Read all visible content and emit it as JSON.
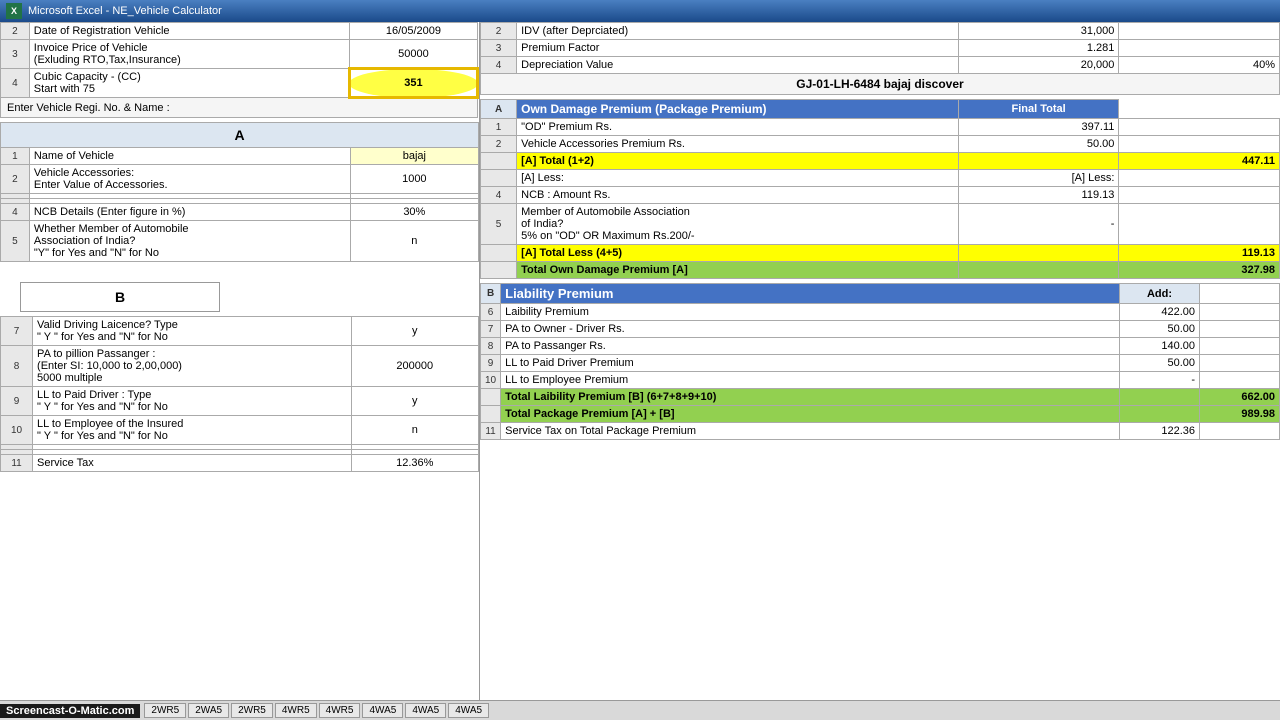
{
  "titleBar": {
    "label": "Microsoft Excel - NE_Vehicle Calculator"
  },
  "topSection": {
    "rows": [
      {
        "num": "2",
        "label": "Date of Registration Vehicle",
        "value": "16/05/2009"
      },
      {
        "num": "3",
        "label1": "Invoice Price of Vehicle",
        "label2": "(Exluding RTO,Tax,Insurance)",
        "value": "50000"
      },
      {
        "num": "4",
        "label1": "Cubic Capacity - (CC)",
        "label2": "Start with 75",
        "value": "351"
      }
    ],
    "regiLabel": "Enter Vehicle Regi. No. & Name :",
    "regiValue": "GJ-01-LH-6484  bajaj discover"
  },
  "rightTopRows": [
    {
      "num": "2",
      "label": "IDV (after Deprciated)",
      "value": "31,000"
    },
    {
      "num": "3",
      "label": "Premium Factor",
      "value": "1.281"
    },
    {
      "num": "4",
      "label": "Depreciation Value",
      "value": "20,000",
      "pct": "40%"
    }
  ],
  "sectionA": {
    "header": "A",
    "tableAHeader": "Own Damage Premium (Package Premium)",
    "finalTotalHeader": "Final Total",
    "rows": [
      {
        "num": "1",
        "label": "Name of Vehicle",
        "value": "bajaj"
      },
      {
        "num": "2",
        "label1": "Vehicle Accessories:",
        "label2": "Enter Value of Accessories.",
        "value": "1000"
      }
    ]
  },
  "rightSectionA": {
    "rows": [
      {
        "num": "1",
        "label": "\"OD\" Premium Rs.",
        "value": "397.11",
        "final": ""
      },
      {
        "num": "2",
        "label": "Vehicle Accessories Premium Rs.",
        "value": "50.00",
        "final": ""
      },
      {
        "totalLabel": "[A]  Total  (1+2)",
        "value": "",
        "final": "447.11",
        "isTotal": true
      },
      {
        "lessLabel1": "[A] Less:",
        "lessLabel2": "[A] Less:",
        "isLess": true
      },
      {
        "num": "4",
        "label": "NCB : Amount Rs.",
        "value": "119.13",
        "final": ""
      },
      {
        "num": "5",
        "label1": "Member of Automobile Association",
        "label2": "of India?",
        "label3": "5% on \"OD\" OR Maximum Rs.200/-",
        "value": "-",
        "final": ""
      },
      {
        "totalLabel": "[A]  Total  Less (4+5)",
        "value": "",
        "final": "119.13",
        "isTotal": true
      },
      {
        "totalLabel": "Total Own Damage Premium   [A]",
        "value": "",
        "final": "327.98",
        "isGreen": true
      }
    ]
  },
  "sectionB": {
    "header": "B",
    "label": "Liability Premium",
    "addLabel": "Add:",
    "rows": [
      {
        "num": "6",
        "label": "Laibility Premium",
        "value": "422.00",
        "final": ""
      },
      {
        "num": "7",
        "label": "PA to Owner - Driver Rs.",
        "value": "50.00",
        "final": ""
      },
      {
        "num": "8",
        "label": "PA to Passanger Rs.",
        "value": "140.00",
        "final": ""
      },
      {
        "num": "9",
        "label": "LL to Paid Driver Premium",
        "value": "50.00",
        "final": ""
      },
      {
        "num": "10",
        "label": "LL to Employee Premium",
        "value": "-",
        "final": ""
      }
    ]
  },
  "leftSectionB": {
    "rows": [
      {
        "num": "7",
        "label1": "Valid Driving Laicence? Type",
        "label2": "\" Y \"  for  Yes and \"N\" for No",
        "value": "y"
      },
      {
        "num": "8",
        "label1": "PA to pillion Passanger :",
        "label2": "(Enter SI: 10,000 to 2,00,000)",
        "label3": "5000 multiple",
        "value": "200000"
      },
      {
        "num": "9",
        "label1": "LL to Paid Driver :  Type",
        "label2": "\" Y \"  for  Yes and \"N\" for No",
        "value": "y"
      },
      {
        "num": "10",
        "label1": "LL to Employee of the Insured",
        "label2": "\" Y \"  for  Yes and \"N\" for No",
        "value": "n"
      }
    ]
  },
  "ncbRow": {
    "num": "4",
    "label": "NCB Details (Enter figure in %)",
    "value": "30%"
  },
  "memberRow": {
    "num": "5",
    "label1": "Whether Member of Automobile",
    "label2": "Association of India?",
    "label3": "\"Y\" for  Yes and \"N\" for No",
    "value": "n"
  },
  "totals": {
    "liabilityTotal": "662.00",
    "liabilityLabel": "Total Laibility Premium   [B]  (6+7+8+9+10)",
    "packageTotal": "989.98",
    "packageLabel": "Total Package Premium   [A] + [B]",
    "serviceTaxLeftNum": "11",
    "serviceTaxLeftLabel": "Service Tax",
    "serviceTaxLeftValue": "12.36%",
    "serviceTaxRightNum": "11",
    "serviceTaxRightLabel": "Service Tax on Total Package Premium",
    "serviceTaxRightValue": "122.36"
  },
  "tabs": [
    "2WR5",
    "2WA5",
    "2WR5",
    "4WR5",
    "4WR5",
    "4WA5",
    "4WA5",
    "4WA5"
  ],
  "watermark": "Screencast-O-Matic.com"
}
